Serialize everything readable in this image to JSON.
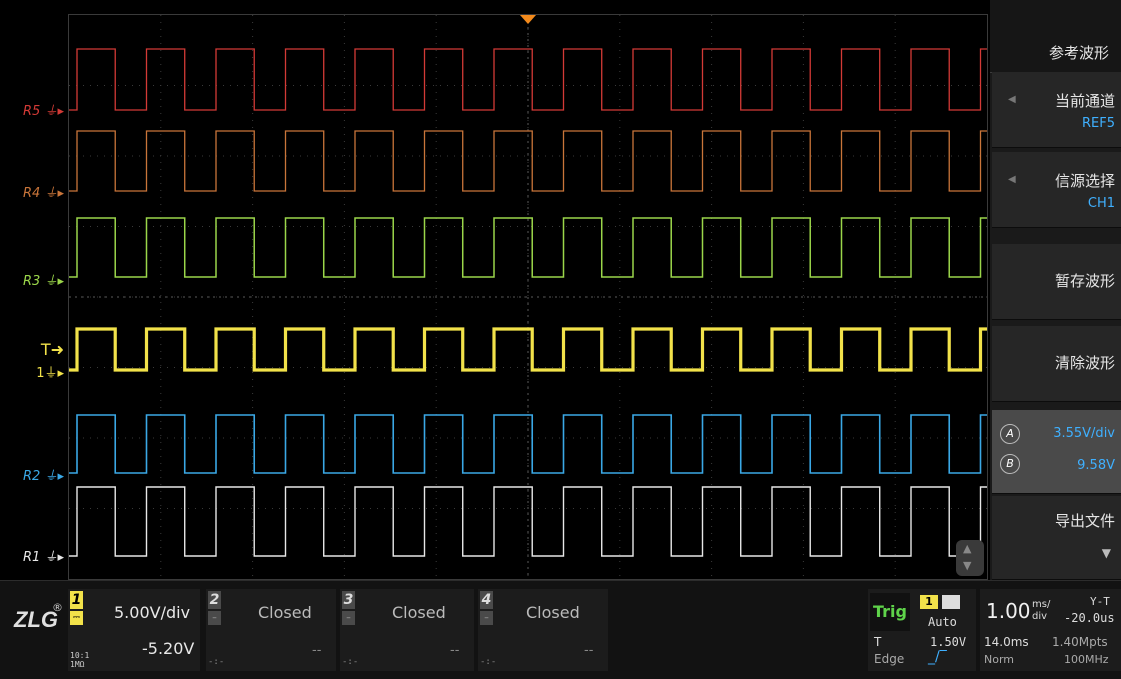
{
  "refs": [
    {
      "name": "R5",
      "color": "#d33a36"
    },
    {
      "name": "R4",
      "color": "#c9753a"
    },
    {
      "name": "R3",
      "color": "#9bd64a"
    },
    {
      "name": "R2",
      "color": "#3aa8e6"
    },
    {
      "name": "R1",
      "color": "#e8e8e8"
    }
  ],
  "channel1_markers": {
    "trigger": "T",
    "ch": "1",
    "color": "#f2e24a"
  },
  "menu": {
    "title": "参考波形",
    "items": [
      {
        "label": "当前通道",
        "value": "REF5"
      },
      {
        "label": "信源选择",
        "value": "CH1"
      },
      {
        "label": "暂存波形"
      },
      {
        "label": "清除波形"
      },
      {
        "scale": "3.55V/div",
        "offset": "9.58V",
        "icon_a": "A",
        "icon_b": "B"
      },
      {
        "label": "导出文件"
      }
    ]
  },
  "logo": "ZLG",
  "channels": [
    {
      "num": "1",
      "scale": "5.00V/div",
      "offset": "-5.20V",
      "probe": "10:1",
      "impedance": "1MΩ",
      "color": "#f2e24a"
    },
    {
      "num": "2",
      "status": "Closed",
      "dash": "--",
      "marks": "-:-"
    },
    {
      "num": "3",
      "status": "Closed",
      "dash": "--",
      "marks": "-:-"
    },
    {
      "num": "4",
      "status": "Closed",
      "dash": "--",
      "marks": "-:-"
    }
  ],
  "trigger": {
    "label": "Trig",
    "ch": "1",
    "mode": "Auto",
    "t": "T",
    "level": "1.50V",
    "type": "Edge"
  },
  "timebase": {
    "value": "1.00",
    "unit_top": "ms/",
    "unit_bottom": "div",
    "mode": "Y-T",
    "delay": "-20.0us",
    "window": "14.0ms",
    "points": "1.40Mpts",
    "acq": "Norm",
    "rate": "100MHz"
  },
  "colors": {
    "accent": "#f28a1c",
    "trig_green": "#5fd34a",
    "menu_value": "#3fb0ff"
  }
}
